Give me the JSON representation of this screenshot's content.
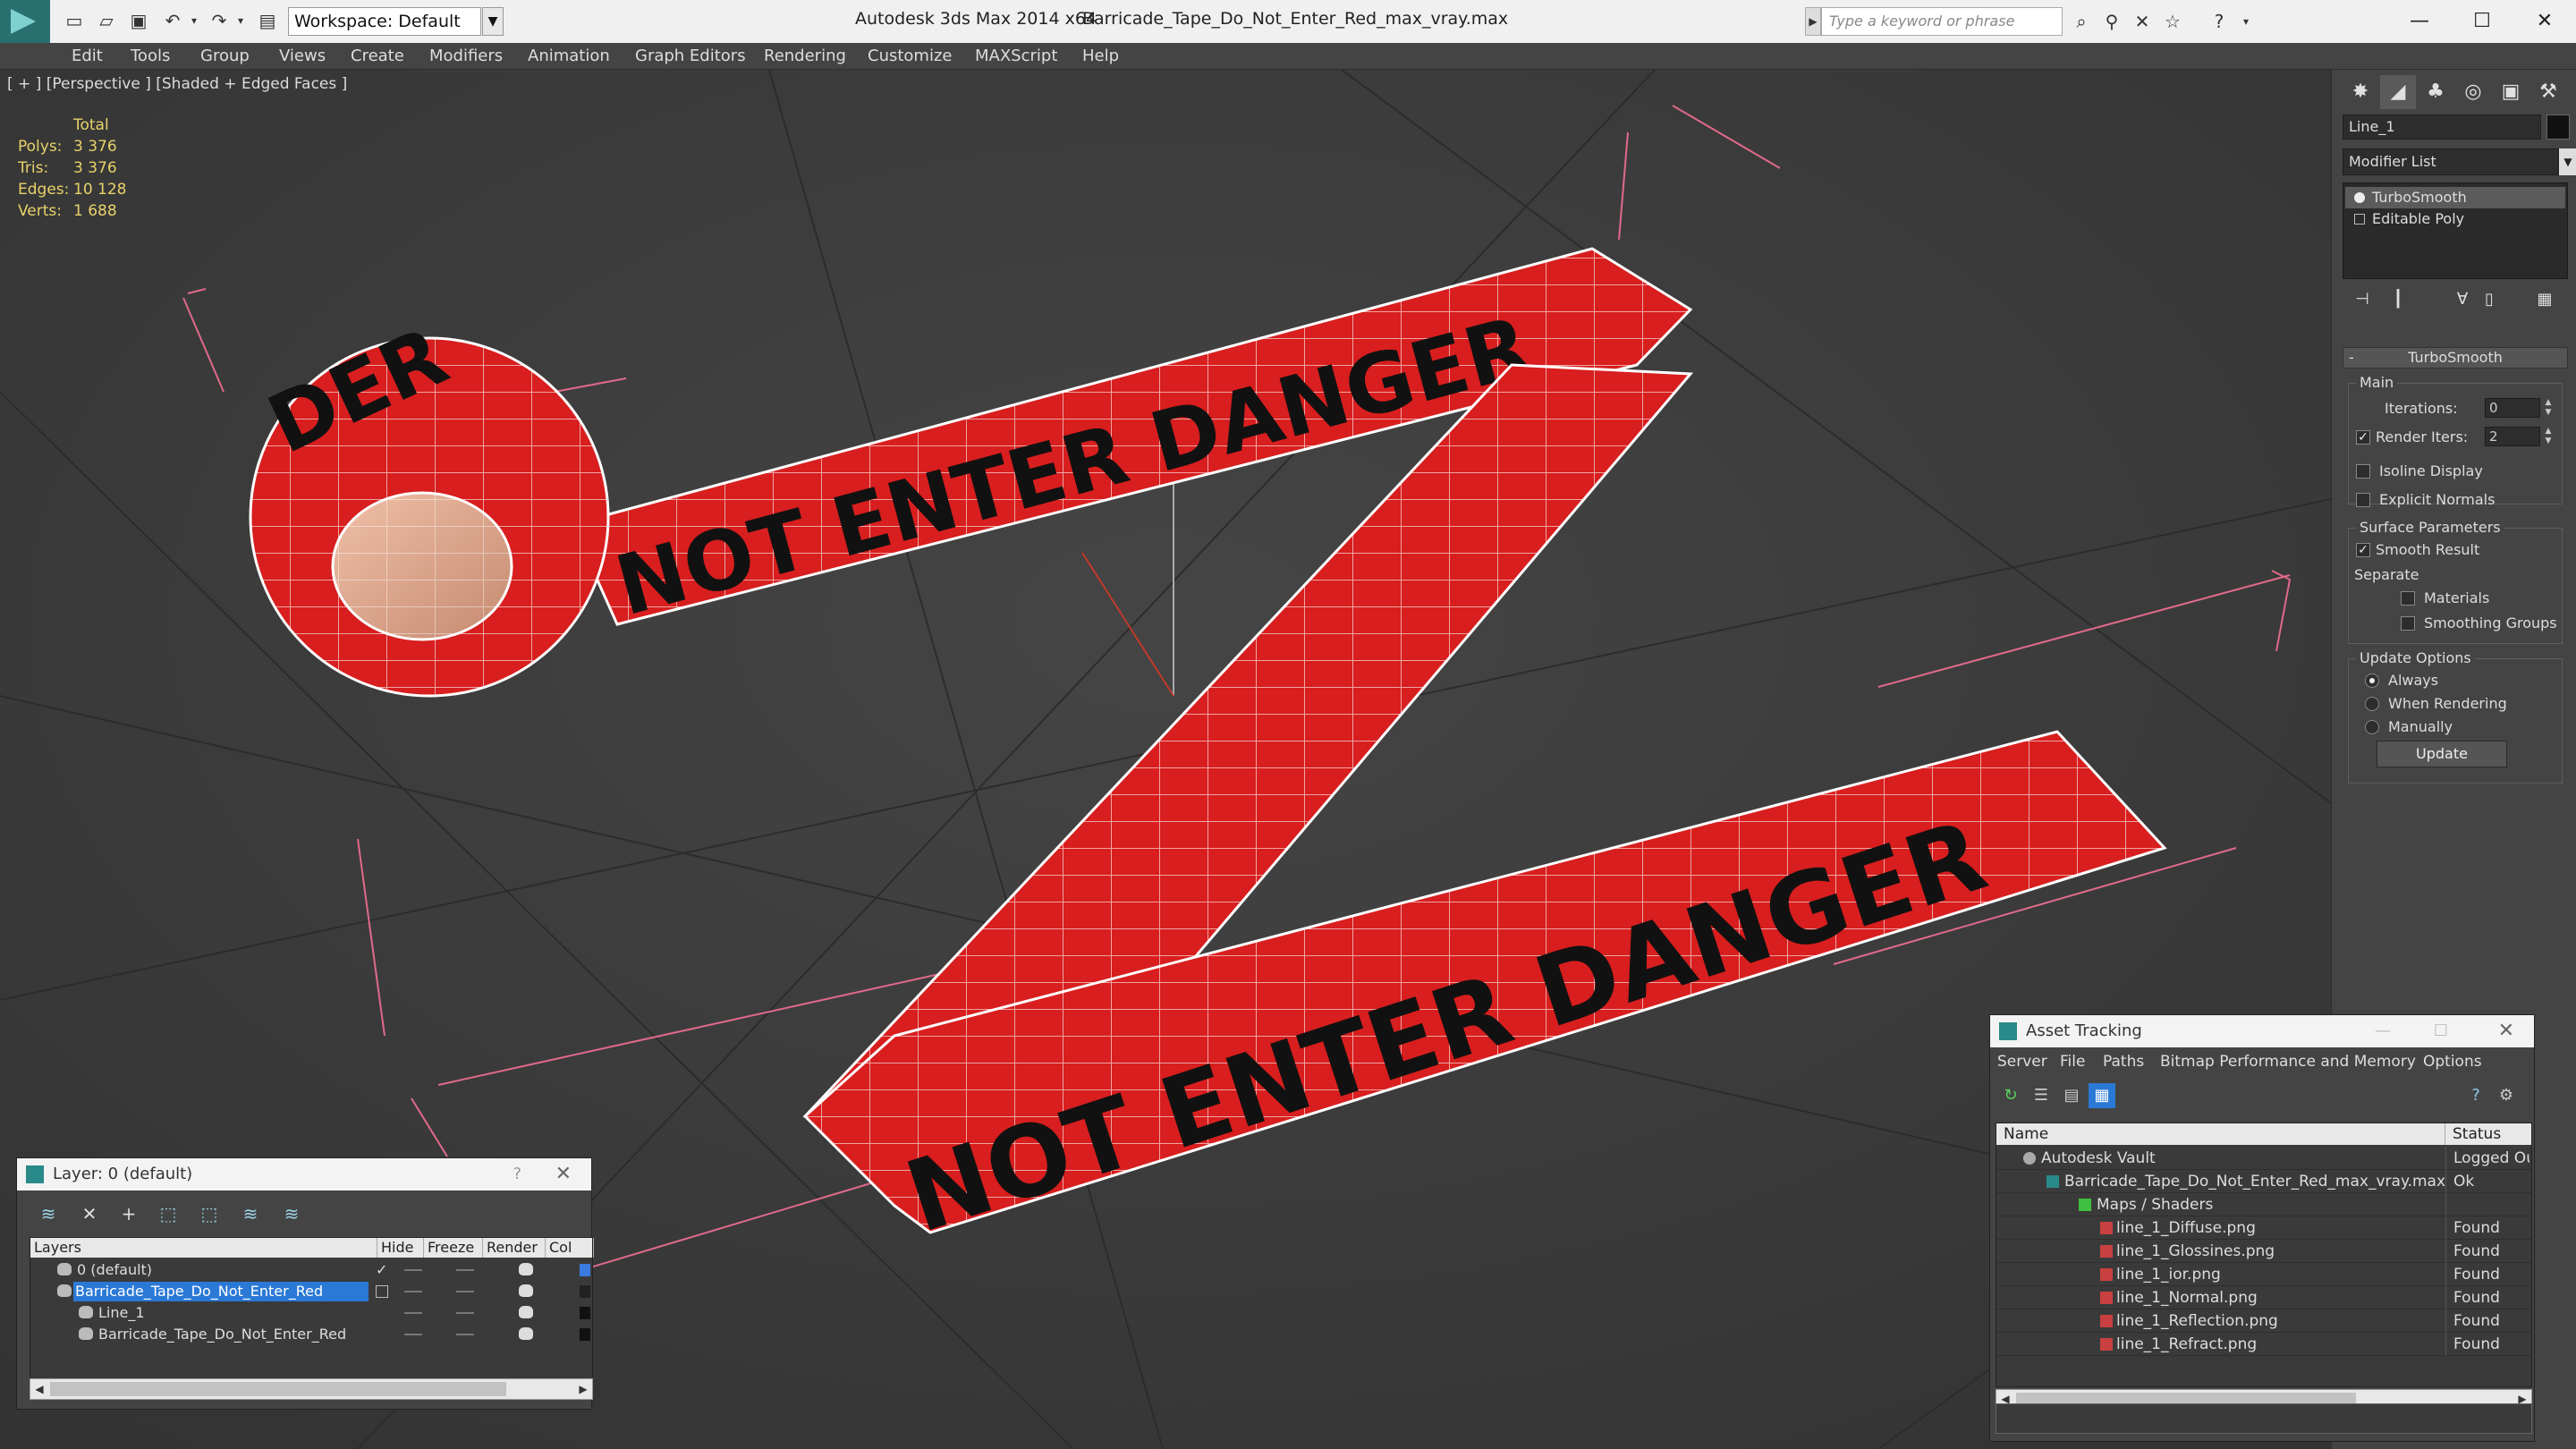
{
  "titlebar": {
    "workspace": "Workspace: Default",
    "app": "Autodesk 3ds Max  2014 x64",
    "file": "Barricade_Tape_Do_Not_Enter_Red_max_vray.max",
    "search_placeholder": "Type a keyword or phrase"
  },
  "menu": [
    "Edit",
    "Tools",
    "Group",
    "Views",
    "Create",
    "Modifiers",
    "Animation",
    "Graph Editors",
    "Rendering",
    "Customize",
    "MAXScript",
    "Help"
  ],
  "viewport": {
    "label": "[ + ] [Perspective ] [Shaded + Edged Faces ]",
    "stats": {
      "header": "Total",
      "rows": [
        {
          "k": "Polys:",
          "v": "3 376"
        },
        {
          "k": "Tris:",
          "v": "3 376"
        },
        {
          "k": "Edges:",
          "v": "10 128"
        },
        {
          "k": "Verts:",
          "v": "1 688"
        }
      ]
    },
    "tape_texts": [
      "NOT ENTER DANGER",
      "NOT ENTER DANGER",
      "DER"
    ]
  },
  "command_panel": {
    "object_name": "Line_1",
    "modifier_list": "Modifier List",
    "stack": [
      "TurboSmooth",
      "Editable Poly"
    ],
    "rollout": "TurboSmooth",
    "main_group": "Main",
    "iterations_label": "Iterations:",
    "iterations_value": "0",
    "render_iters_label": "Render Iters:",
    "render_iters_value": "2",
    "isoline": "Isoline Display",
    "explicit_normals": "Explicit Normals",
    "surface_group": "Surface Parameters",
    "smooth_result": "Smooth Result",
    "separate": "Separate",
    "materials": "Materials",
    "smoothing_groups": "Smoothing Groups",
    "update_group": "Update Options",
    "always": "Always",
    "when_rendering": "When Rendering",
    "manually": "Manually",
    "update_button": "Update"
  },
  "layer_dialog": {
    "title": "Layer: 0 (default)",
    "help": "?",
    "columns": [
      "Layers",
      "Hide",
      "Freeze",
      "Render",
      "Col"
    ],
    "rows": [
      "0 (default)",
      "Barricade_Tape_Do_Not_Enter_Red",
      "Line_1",
      "Barricade_Tape_Do_Not_Enter_Red"
    ]
  },
  "asset_dialog": {
    "title": "Asset Tracking",
    "menu": [
      "Server",
      "File",
      "Paths",
      "Bitmap Performance and Memory",
      "Options"
    ],
    "columns": [
      "Name",
      "Status"
    ],
    "rows": [
      {
        "name": "Autodesk Vault",
        "status": "Logged Ou"
      },
      {
        "name": "Barricade_Tape_Do_Not_Enter_Red_max_vray.max",
        "status": "Ok"
      },
      {
        "name": "Maps / Shaders",
        "status": ""
      },
      {
        "name": "line_1_Diffuse.png",
        "status": "Found"
      },
      {
        "name": "line_1_Glossines.png",
        "status": "Found"
      },
      {
        "name": "line_1_ior.png",
        "status": "Found"
      },
      {
        "name": "line_1_Normal.png",
        "status": "Found"
      },
      {
        "name": "line_1_Reflection.png",
        "status": "Found"
      },
      {
        "name": "line_1_Refract.png",
        "status": "Found"
      }
    ]
  }
}
